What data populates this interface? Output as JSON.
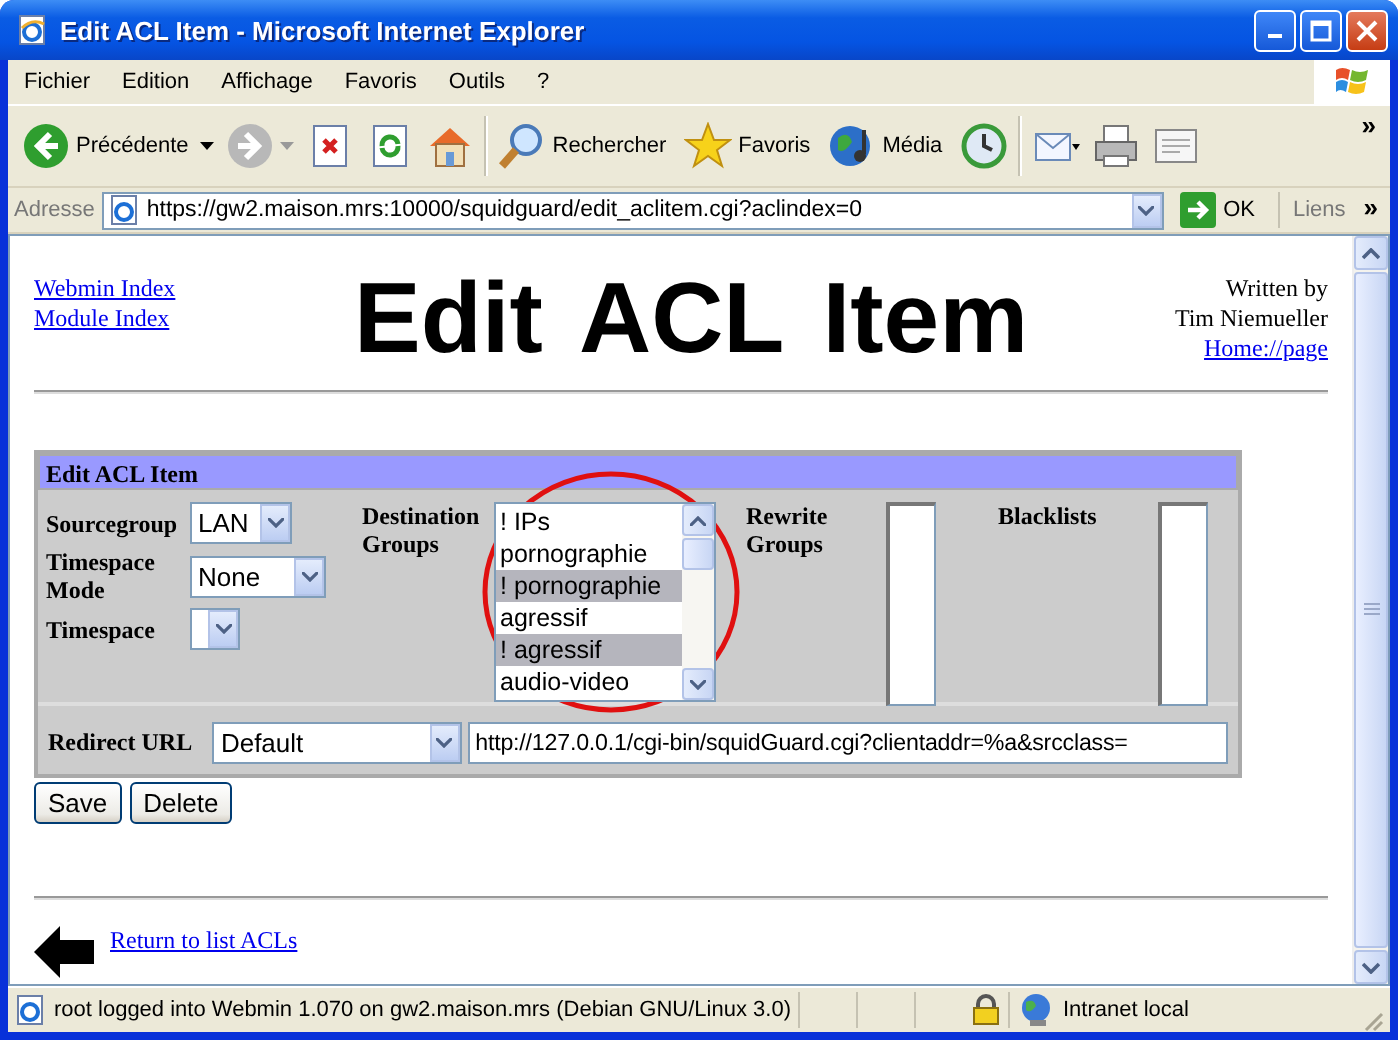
{
  "window": {
    "title": "Edit ACL Item - Microsoft Internet Explorer"
  },
  "menu": [
    "Fichier",
    "Edition",
    "Affichage",
    "Favoris",
    "Outils",
    "?"
  ],
  "toolbar": [
    {
      "kind": "back",
      "label": "Précédente"
    },
    {
      "kind": "forward"
    },
    {
      "kind": "stop"
    },
    {
      "kind": "refresh"
    },
    {
      "kind": "home"
    },
    {
      "kind": "search",
      "label": "Rechercher"
    },
    {
      "kind": "favorites",
      "label": "Favoris"
    },
    {
      "kind": "media",
      "label": "Média"
    },
    {
      "kind": "history"
    },
    {
      "kind": "mail"
    },
    {
      "kind": "print"
    },
    {
      "kind": "edit"
    }
  ],
  "toolbar_more": "»",
  "address_bar": {
    "label": "Adresse",
    "url": "https://gw2.maison.mrs:10000/squidguard/edit_aclitem.cgi?aclindex=0",
    "go": "OK",
    "links": "Liens",
    "more": "»"
  },
  "page": {
    "nav_links": [
      "Webmin Index",
      "Module Index"
    ],
    "title": "Edit ACL Item",
    "author": [
      "Written by",
      "Tim Niemueller"
    ],
    "author_link": "Home://page",
    "form": {
      "header": "Edit ACL Item",
      "sourcegroup": {
        "label": "Sourcegroup",
        "value": "LAN"
      },
      "timespace_mode": {
        "label": "Timespace Mode",
        "value": "None"
      },
      "timespace": {
        "label": "Timespace"
      },
      "destination_groups": {
        "label": "Destination Groups",
        "items": [
          {
            "label": "! IPs",
            "selected": false
          },
          {
            "label": "pornographie",
            "selected": false
          },
          {
            "label": "! pornographie",
            "selected": true
          },
          {
            "label": "agressif",
            "selected": false
          },
          {
            "label": "! agressif",
            "selected": true
          },
          {
            "label": "audio-video",
            "selected": false
          }
        ]
      },
      "rewrite_groups": {
        "label": "Rewrite Groups"
      },
      "blacklists": {
        "label": "Blacklists"
      },
      "redirect": {
        "label": "Redirect URL",
        "mode": "Default",
        "url": "http://127.0.0.1/cgi-bin/squidGuard.cgi?clientaddr=%a&srcclass="
      }
    },
    "buttons": [
      "Save",
      "Delete"
    ],
    "return_link": "Return to list ACLs"
  },
  "status_bar": {
    "text": "root logged into Webmin 1.070 on gw2.maison.mrs (Debian GNU/Linux 3.0)",
    "zone": "Intranet local"
  }
}
